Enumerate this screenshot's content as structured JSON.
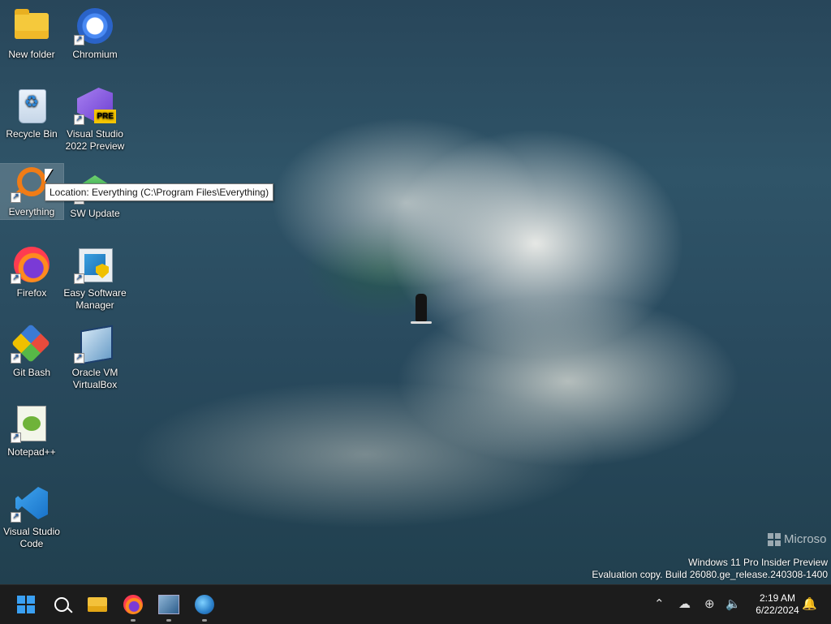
{
  "desktop": {
    "icons": [
      {
        "id": "new-folder",
        "label": "New folder"
      },
      {
        "id": "chromium",
        "label": "Chromium"
      },
      {
        "id": "recycle-bin",
        "label": "Recycle Bin"
      },
      {
        "id": "visual-studio",
        "label_line1": "Visual Studio",
        "label_line2": "2022 Preview",
        "badge": "PRE"
      },
      {
        "id": "everything",
        "label": "Everything"
      },
      {
        "id": "sw-update",
        "label": "SW Update"
      },
      {
        "id": "firefox",
        "label": "Firefox"
      },
      {
        "id": "easy-software-manager",
        "label_line1": "Easy Software",
        "label_line2": "Manager"
      },
      {
        "id": "git-bash",
        "label": "Git Bash"
      },
      {
        "id": "virtualbox",
        "label_line1": "Oracle VM",
        "label_line2": "VirtualBox"
      },
      {
        "id": "notepadpp",
        "label": "Notepad++"
      },
      {
        "id": "vscode",
        "label_line1": "Visual Studio",
        "label_line2": "Code"
      }
    ],
    "tooltip": "Location: Everything (C:\\Program Files\\Everything)"
  },
  "watermark": {
    "logo_text": "Microso",
    "line1": "Windows 11 Pro Insider Preview",
    "line2": "Evaluation copy. Build 26080.ge_release.240308-1400"
  },
  "taskbar": {
    "items": [
      "start-icon",
      "search-icon",
      "file-explorer-icon",
      "firefox-icon",
      "app-icon",
      "globe-icon"
    ],
    "tray": {
      "icons": [
        "chevron-up-icon",
        "onedrive-icon",
        "network-icon",
        "volume-icon"
      ],
      "time": "2:19 AM",
      "date": "6/22/2024",
      "notification_icon": "bell-icon"
    }
  },
  "colors": {
    "taskbar_bg": "#1c1c1c",
    "start_blue": "#3aa0f3"
  }
}
